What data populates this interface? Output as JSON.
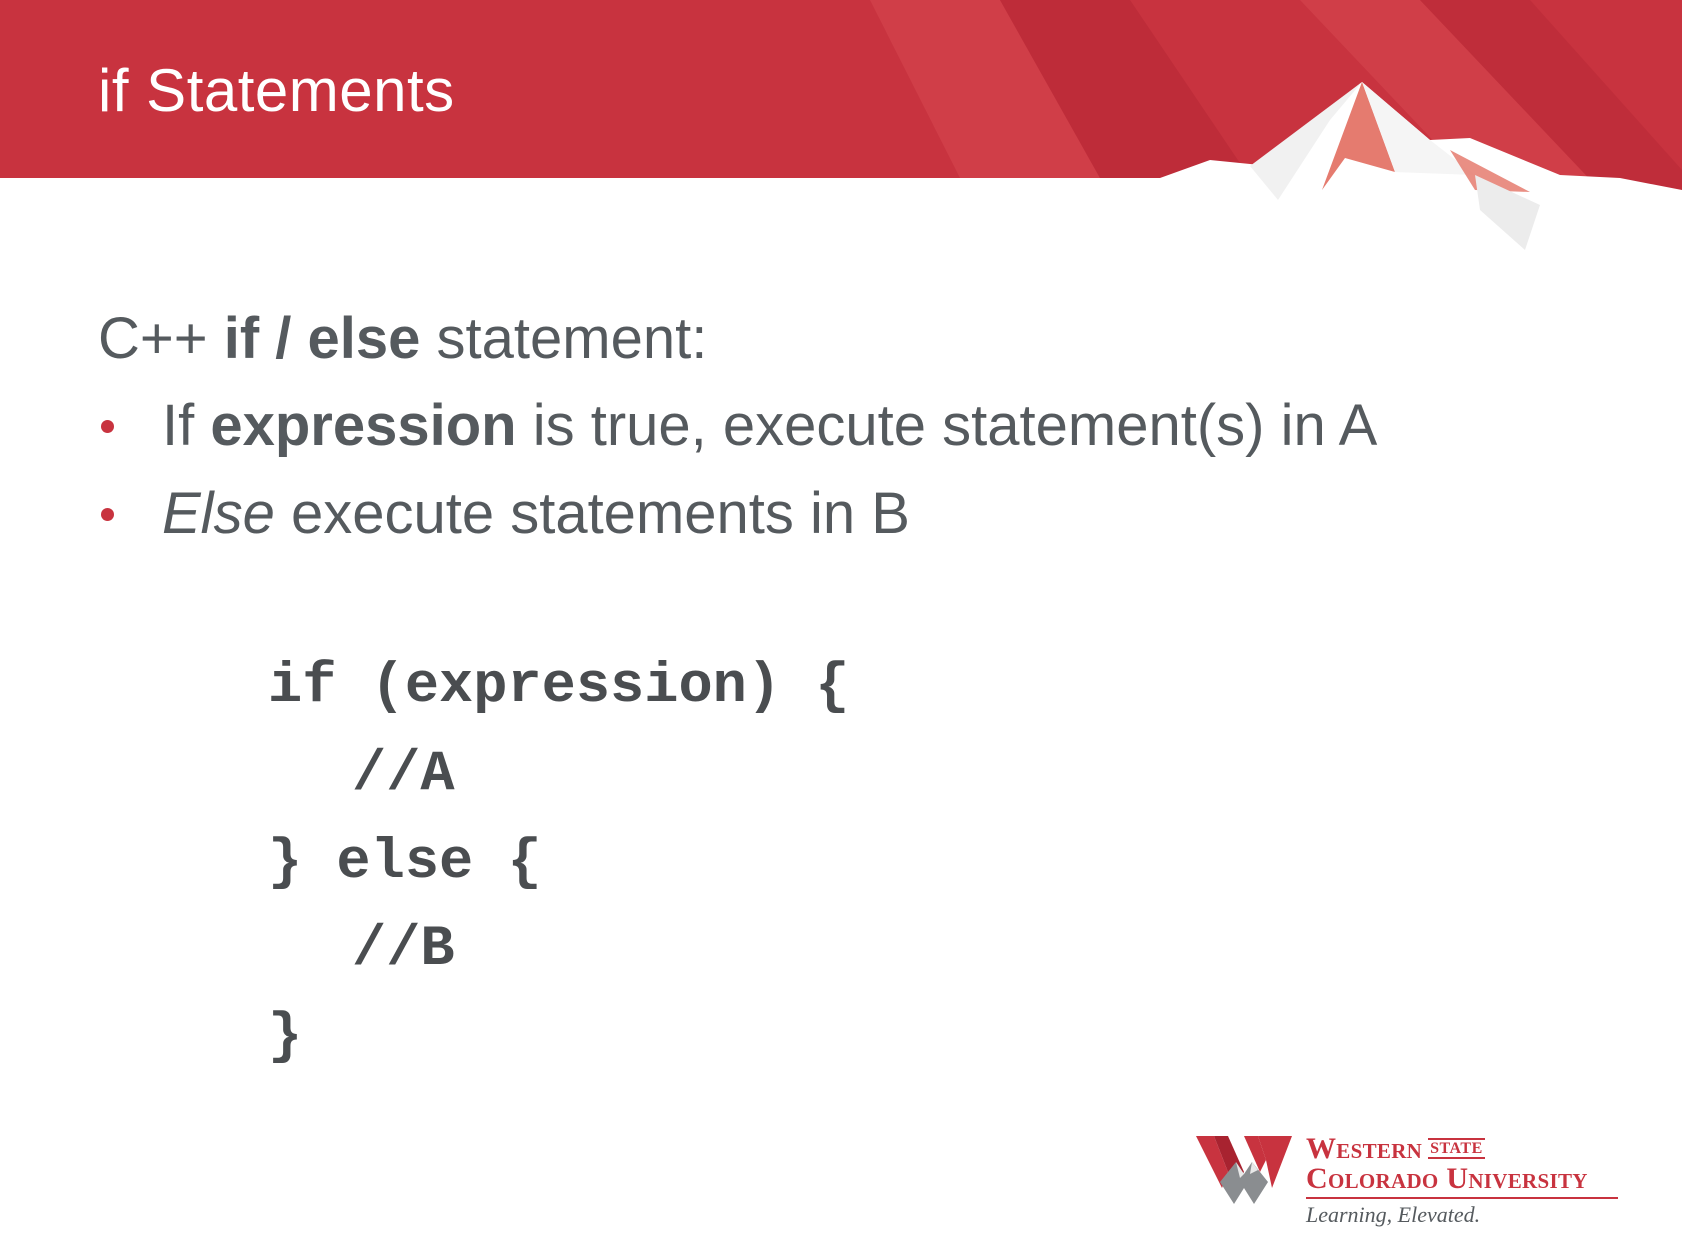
{
  "header": {
    "title": "if Statements",
    "band_color": "#c8333f"
  },
  "content": {
    "intro": {
      "prefix": "C++ ",
      "bold": "if / else",
      "suffix": " statement:"
    },
    "bullets": [
      {
        "lead": "If ",
        "bold": "expression",
        "rest": " is true, execute statement(s) in A"
      },
      {
        "italic": "Else",
        "rest": " execute statements in B"
      }
    ],
    "bullet_color": "#c8333f",
    "code_lines": [
      "if (expression) {",
      "//A",
      "} else {",
      "//B",
      "}"
    ]
  },
  "logo": {
    "line1": "Western",
    "state": "STATE",
    "line2": "Colorado University",
    "tagline": "Learning, Elevated."
  }
}
